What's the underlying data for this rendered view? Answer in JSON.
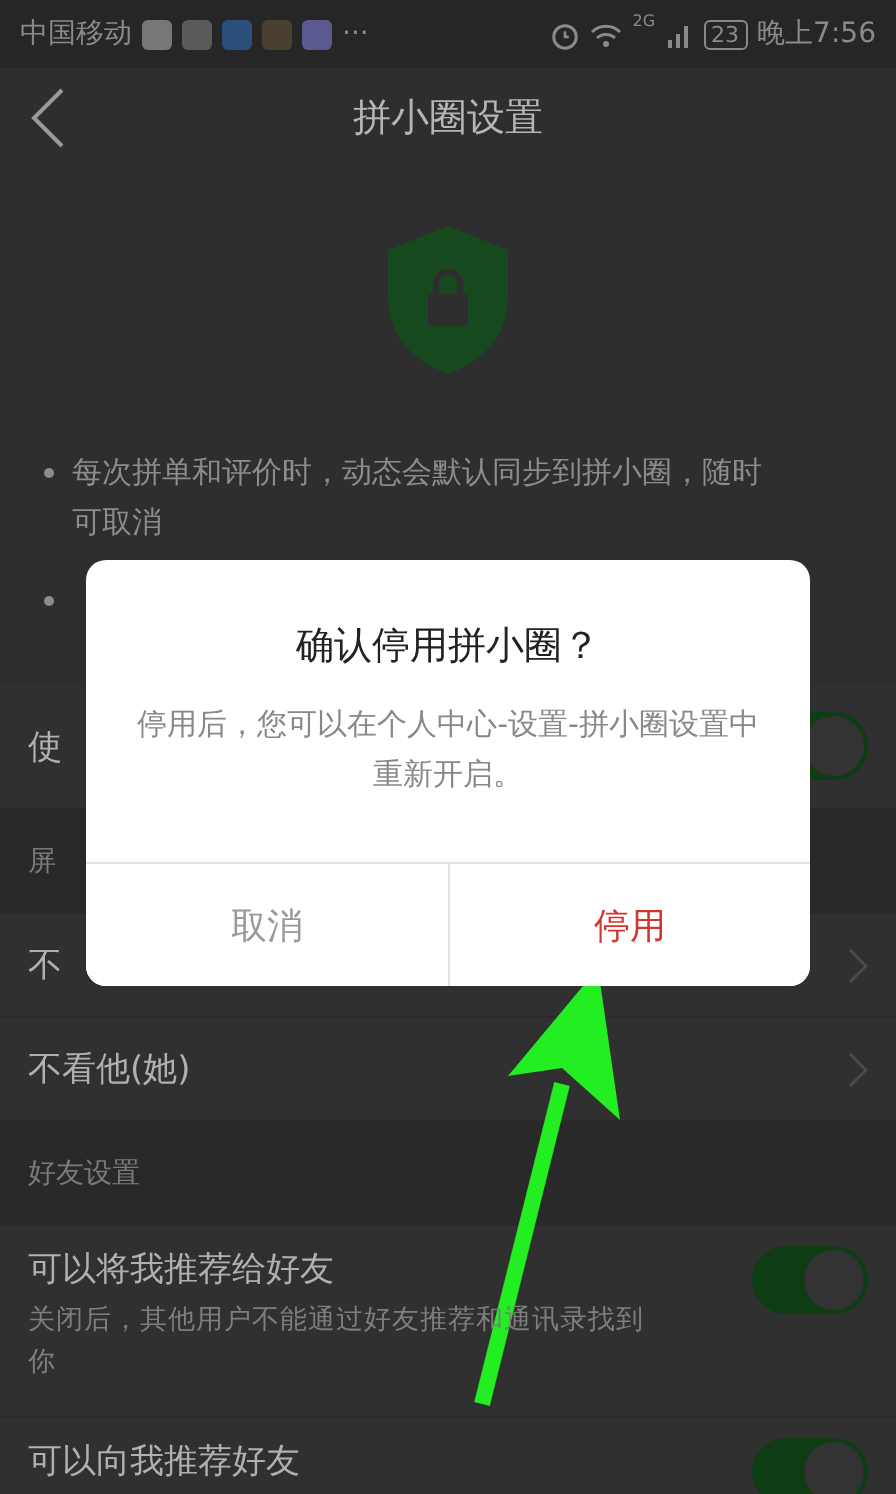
{
  "status_bar": {
    "carrier": "中国移动",
    "more": "···",
    "network": "2G",
    "battery": "23",
    "time": "晚上7:56"
  },
  "header": {
    "title": "拼小圈设置"
  },
  "notes": [
    {
      "text": "每次拼单和评价时，动态会默认同步到拼小圈，随时可取消"
    },
    {
      "covered": true
    }
  ],
  "rows": [
    {
      "kind": "toggle",
      "label": "使",
      "on": true
    },
    {
      "kind": "section",
      "label": "屏"
    },
    {
      "kind": "link",
      "label": "不"
    },
    {
      "kind": "link",
      "label": "不看他(她)"
    },
    {
      "kind": "section",
      "label": "好友设置"
    },
    {
      "kind": "toggle",
      "label": "可以将我推荐给好友",
      "hint": "关闭后，其他用户不能通过好友推荐和通讯录找到你",
      "on": true
    },
    {
      "kind": "toggle",
      "label": "可以向我推荐好友",
      "on": true
    }
  ],
  "dialog": {
    "title": "确认停用拼小圈？",
    "message": "停用后，您可以在个人中心-设置-拼小圈设置中重新开启。",
    "buttons": [
      {
        "label": "取消",
        "kind": "cancel"
      },
      {
        "label": "停用",
        "kind": "danger"
      }
    ]
  }
}
